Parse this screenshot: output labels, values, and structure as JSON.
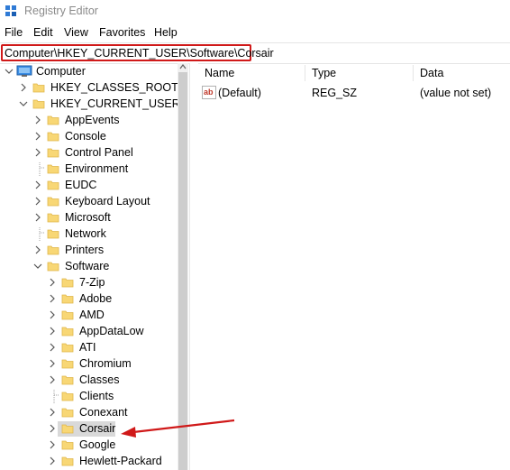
{
  "window": {
    "title": "Registry Editor"
  },
  "menu": [
    {
      "label": "File"
    },
    {
      "label": "Edit"
    },
    {
      "label": "View"
    },
    {
      "label": "Favorites"
    },
    {
      "label": "Help"
    }
  ],
  "address": {
    "path": "Computer\\HKEY_CURRENT_USER\\Software\\Corsair"
  },
  "tree": {
    "root": "Computer",
    "hives": {
      "classes_root": "HKEY_CLASSES_ROOT",
      "current_user": "HKEY_CURRENT_USER"
    },
    "current_user_children": [
      {
        "label": "AppEvents",
        "expandable": true
      },
      {
        "label": "Console",
        "expandable": true
      },
      {
        "label": "Control Panel",
        "expandable": true
      },
      {
        "label": "Environment",
        "expandable": false
      },
      {
        "label": "EUDC",
        "expandable": true
      },
      {
        "label": "Keyboard Layout",
        "expandable": true
      },
      {
        "label": "Microsoft",
        "expandable": true
      },
      {
        "label": "Network",
        "expandable": false
      },
      {
        "label": "Printers",
        "expandable": true
      },
      {
        "label": "Software",
        "expandable": true,
        "expanded": true
      }
    ],
    "software_children": [
      {
        "label": "7-Zip",
        "expandable": true
      },
      {
        "label": "Adobe",
        "expandable": true
      },
      {
        "label": "AMD",
        "expandable": true
      },
      {
        "label": "AppDataLow",
        "expandable": true
      },
      {
        "label": "ATI",
        "expandable": true
      },
      {
        "label": "Chromium",
        "expandable": true
      },
      {
        "label": "Classes",
        "expandable": true
      },
      {
        "label": "Clients",
        "expandable": false
      },
      {
        "label": "Conexant",
        "expandable": true
      },
      {
        "label": "Corsair",
        "expandable": true,
        "selected": true
      },
      {
        "label": "Google",
        "expandable": true
      },
      {
        "label": "Hewlett-Packard",
        "expandable": true
      }
    ]
  },
  "values": {
    "columns": [
      "Name",
      "Type",
      "Data"
    ],
    "rows": [
      {
        "name": "(Default)",
        "type": "REG_SZ",
        "data": "(value not set)"
      }
    ]
  },
  "colors": {
    "highlight_red": "#d01919",
    "folder_yellow": "#f8d775",
    "folder_dark": "#e0b64a",
    "selected_bg": "#d9d9d9"
  }
}
